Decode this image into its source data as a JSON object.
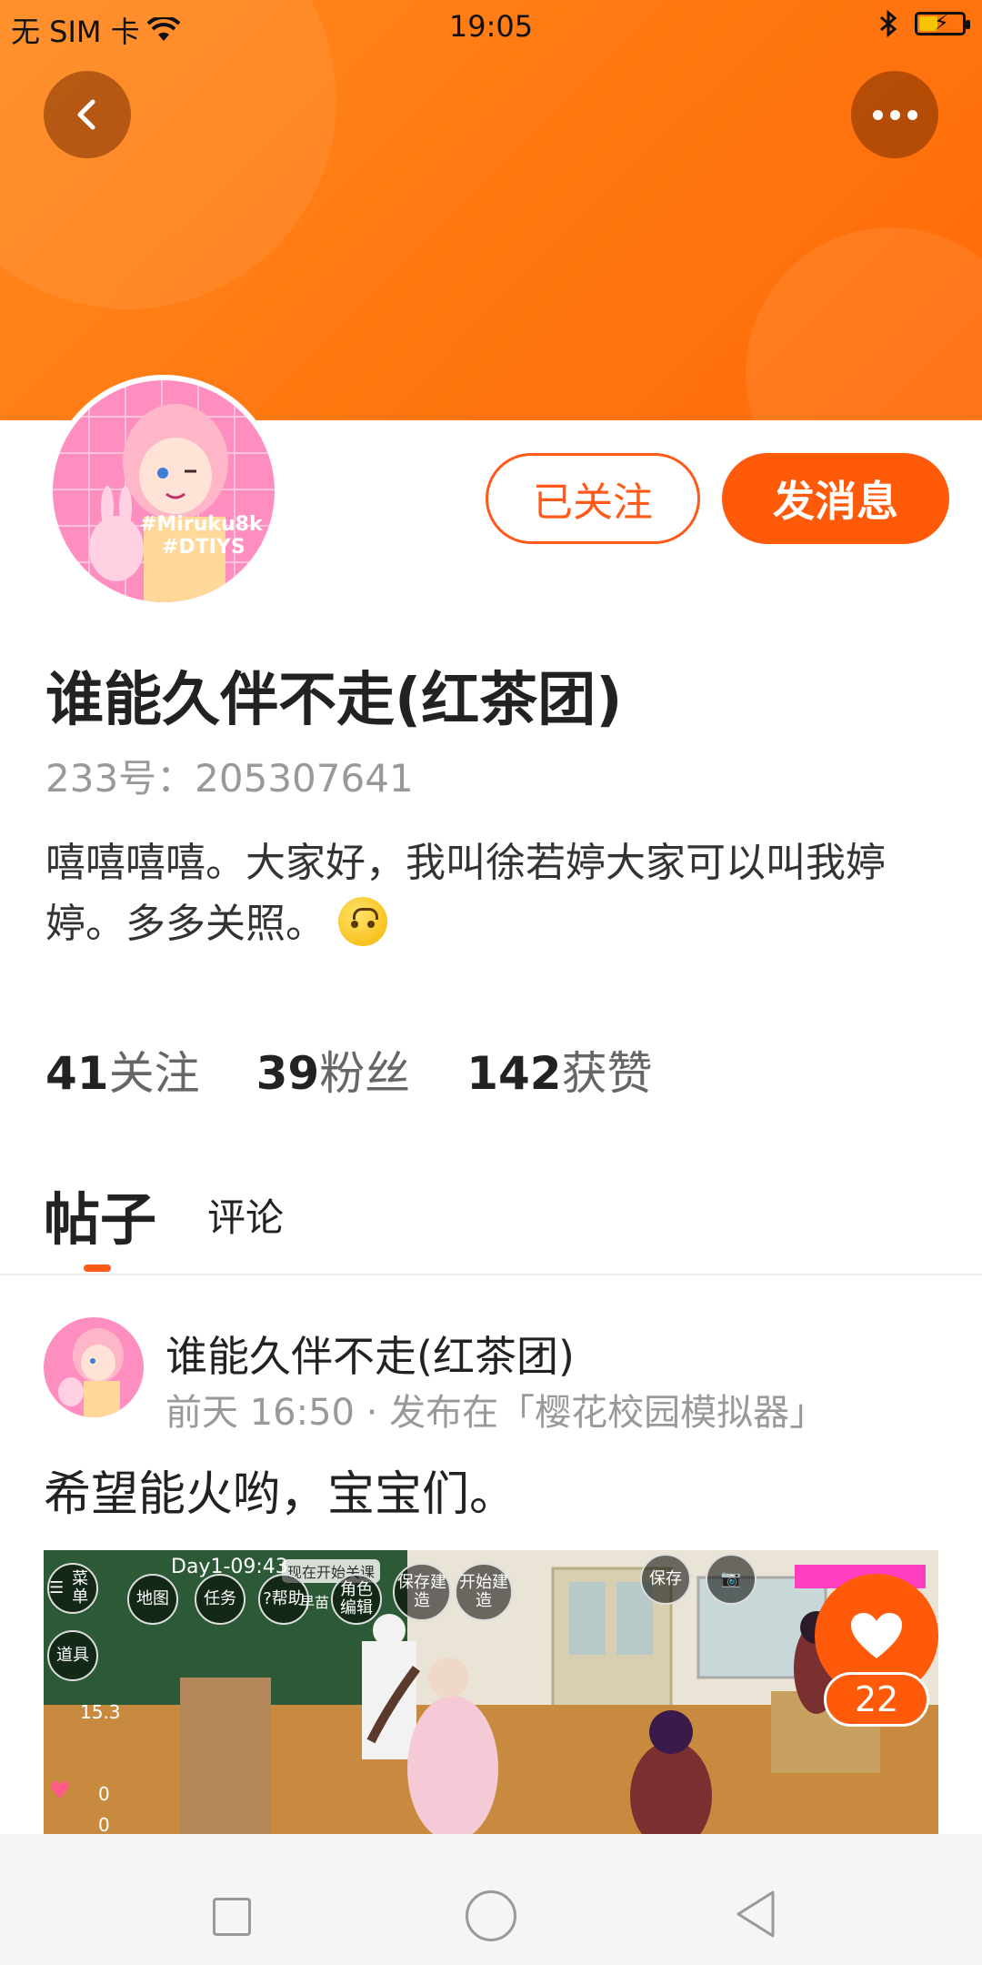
{
  "status_bar": {
    "carrier": "无 SIM 卡",
    "time": "19:05"
  },
  "header": {
    "background_color": "#ff7a12"
  },
  "profile": {
    "followed_label": "已关注",
    "message_label": "发消息",
    "name": "谁能久伴不走(红茶团)",
    "uid": "233号：205307641",
    "bio": "嘻嘻嘻嘻。大家好，我叫徐若婷大家可以叫我婷婷。多多关照。",
    "avatar_text_1": "#Miruku8k",
    "avatar_text_2": "#DTIYS",
    "stats": [
      {
        "num": "41",
        "label": "关注"
      },
      {
        "num": "39",
        "label": "粉丝"
      },
      {
        "num": "142",
        "label": "获赞"
      }
    ]
  },
  "tabs": {
    "posts": "帖子",
    "comments": "评论"
  },
  "post": {
    "author": "谁能久伴不走(红茶团)",
    "meta": "前天 16:50 · 发布在「樱花校园模拟器」",
    "text": "希望能火哟，宝宝们。",
    "likes": "22",
    "game_ui": {
      "day_time": "Day1-09:43",
      "notice": "现在开始关课",
      "menu": "菜单",
      "map": "地图",
      "task": "任务",
      "help": "帮助",
      "grass": "早苗",
      "role_edit": "角色编辑",
      "save_build": "保存建造",
      "start_build": "开始建造",
      "save": "保存",
      "items": "道具",
      "money": "15.3",
      "hearts": "0",
      "people": "0"
    }
  },
  "colors": {
    "accent": "#ff5a0a",
    "gray_text": "#999999"
  }
}
